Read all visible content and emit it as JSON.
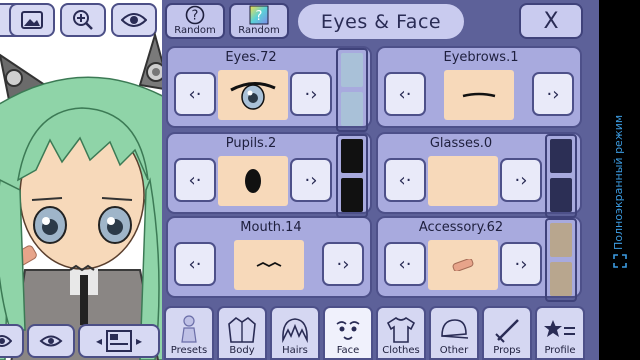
{
  "panel": {
    "title": "Eyes & Face",
    "close_label": "X",
    "random_buttons": [
      {
        "label": "Random",
        "icon": "question-mark-icon"
      },
      {
        "label": "Random",
        "icon": "random-color-icon"
      }
    ]
  },
  "features": [
    {
      "name": "Eyes.72",
      "colors": [
        "#a9c1d8",
        "#a9c1d8"
      ]
    },
    {
      "name": "Eyebrows.1",
      "colors": []
    },
    {
      "name": "Pupils.2",
      "colors": [
        "#111111",
        "#111111"
      ]
    },
    {
      "name": "Glasses.0",
      "colors": [
        "#2c2f55",
        "#2c2f55"
      ]
    },
    {
      "name": "Mouth.14",
      "colors": []
    },
    {
      "name": "Accessory.62",
      "colors": [
        "#b8a68e",
        "#b8a68e"
      ]
    }
  ],
  "tabs": [
    {
      "label": "Presets",
      "icon": "presets-figure-icon"
    },
    {
      "label": "Body",
      "icon": "jacket-icon"
    },
    {
      "label": "Hairs",
      "icon": "hair-icon"
    },
    {
      "label": "Face",
      "icon": "face-icon",
      "active": true
    },
    {
      "label": "Clothes",
      "icon": "shirt-icon"
    },
    {
      "label": "Other",
      "icon": "cap-icon"
    },
    {
      "label": "Props",
      "icon": "sword-icon"
    },
    {
      "label": "Profile",
      "icon": "star-list-icon"
    }
  ],
  "toolbar_icons": [
    "image-icon",
    "zoom-in-icon",
    "eye-icon",
    "eye-reset-icon",
    "layout-icon"
  ],
  "system": {
    "fullscreen_label": "Полноэкранный режим"
  },
  "colors": {
    "panel": "#5d6199",
    "card": "#a8aade",
    "skin": "#f7d9ba",
    "hair": "#8fd4a8"
  }
}
